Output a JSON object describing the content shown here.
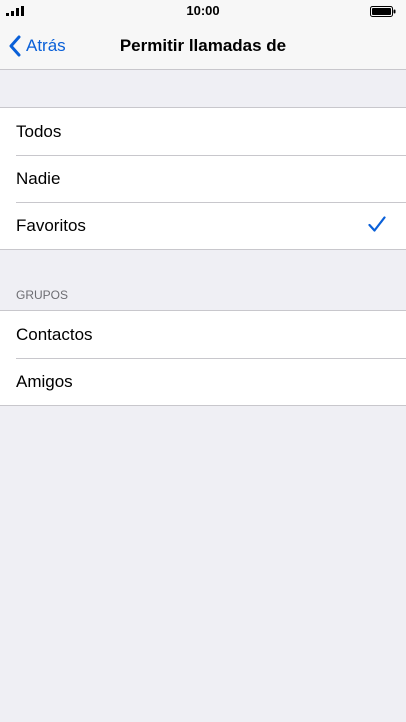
{
  "status_bar": {
    "time": "10:00"
  },
  "nav": {
    "back_label": "Atrás",
    "title": "Permitir llamadas de"
  },
  "options": [
    {
      "label": "Todos",
      "selected": false
    },
    {
      "label": "Nadie",
      "selected": false
    },
    {
      "label": "Favoritos",
      "selected": true
    }
  ],
  "groups": {
    "header": "GRUPOS",
    "items": [
      {
        "label": "Contactos"
      },
      {
        "label": "Amigos"
      }
    ]
  },
  "colors": {
    "accent": "#0a60d8",
    "background": "#efeff4",
    "separator": "#c8c7cc"
  },
  "icons": {
    "signal": "signal-bars-icon",
    "battery": "battery-icon",
    "back": "chevron-left-icon",
    "check": "checkmark-icon"
  }
}
